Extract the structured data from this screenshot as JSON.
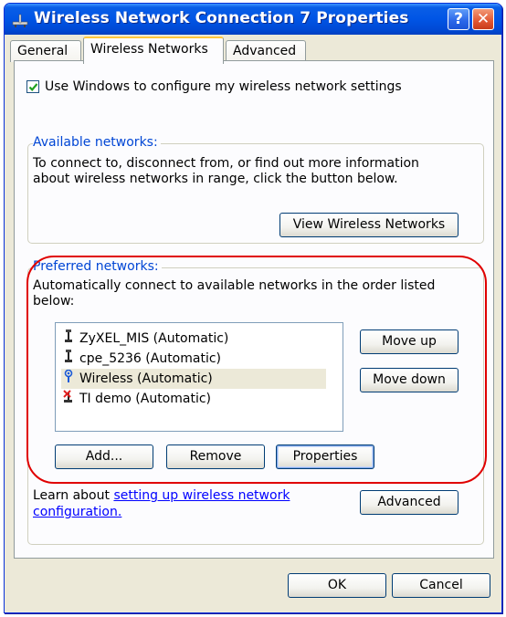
{
  "window": {
    "title": "Wireless Network Connection 7 Properties",
    "help_label": "?",
    "close_label": "✕"
  },
  "tabs": [
    {
      "label": "General",
      "active": false
    },
    {
      "label": "Wireless Networks",
      "active": true
    },
    {
      "label": "Advanced",
      "active": false
    }
  ],
  "use_windows": {
    "checked": true,
    "label": "Use Windows to configure my wireless network settings"
  },
  "available": {
    "label": "Available networks:",
    "description_line1": "To connect to, disconnect from, or find out more information",
    "description_line2": "about wireless networks in range, click the button below.",
    "view_button": "View Wireless Networks"
  },
  "preferred": {
    "label": "Preferred networks:",
    "description_line1": "Automatically connect to available networks in the order listed",
    "description_line2": "below:",
    "networks": [
      {
        "name": "ZyXEL_MIS (Automatic)",
        "icon": "antenna-icon",
        "selected": false
      },
      {
        "name": "cpe_5236 (Automatic)",
        "icon": "antenna-icon",
        "selected": false
      },
      {
        "name": "Wireless (Automatic)",
        "icon": "wireless-connected-icon",
        "selected": true
      },
      {
        "name": "TI demo (Automatic)",
        "icon": "antenna-unavailable-icon",
        "selected": false
      }
    ],
    "move_up": "Move up",
    "move_down": "Move down",
    "add": "Add...",
    "remove": "Remove",
    "properties": "Properties"
  },
  "learn": {
    "prefix": "Learn about ",
    "link_line1": "setting up wireless network",
    "link_line2": "configuration.",
    "advanced_button": "Advanced"
  },
  "footer": {
    "ok": "OK",
    "cancel": "Cancel"
  },
  "colors": {
    "titlebar": "#0055e5",
    "group_label": "#0046d5",
    "highlight": "#e00000",
    "link": "#0000ff"
  }
}
